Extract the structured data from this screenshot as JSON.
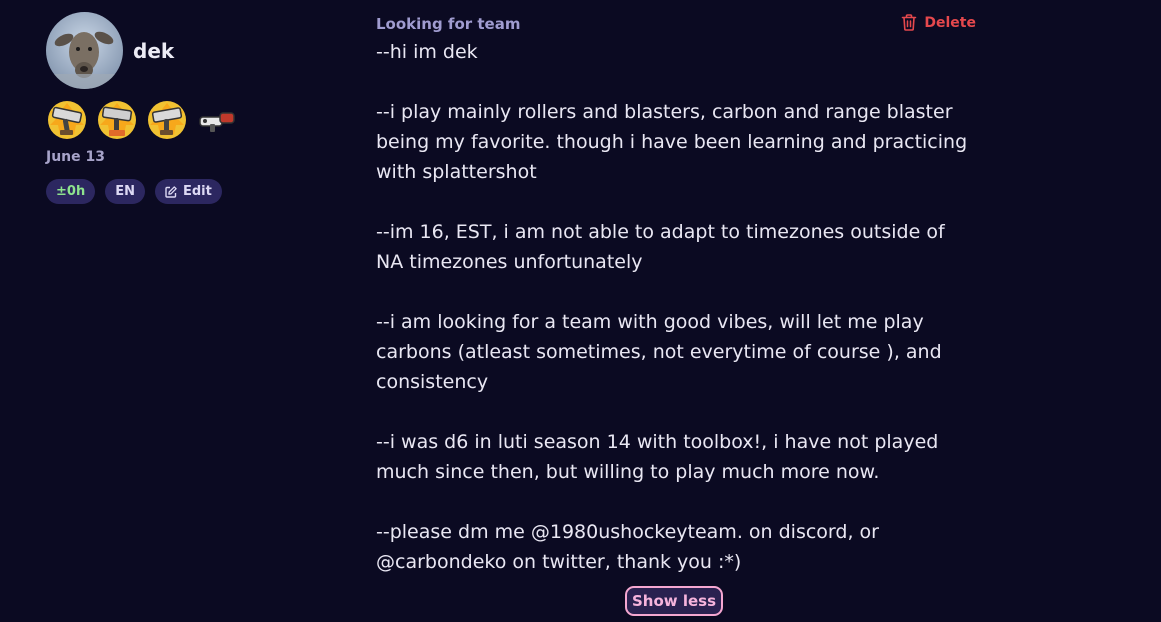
{
  "user": {
    "name": "dek",
    "date": "June 13",
    "weapons": [
      "carbon-roller-icon",
      "carbon-roller-deco-icon",
      "carbon-roller-icon",
      "range-blaster-icon"
    ],
    "pills": {
      "timezone": "±0h",
      "language": "EN",
      "edit": "Edit"
    }
  },
  "post": {
    "type": "Looking for team",
    "delete_label": "Delete",
    "text": "--hi im dek\n\n--i play mainly rollers and blasters, carbon and range blaster being my favorite. though i have been learning and practicing with splattershot\n\n--im 16, EST, i am not able to adapt to timezones outside of NA timezones unfortunately\n\n--i am looking for a team with good vibes, will let me play carbons (atleast sometimes, not everytime of course ), and consistency\n\n--i was d6 in luti season 14 with toolbox!, i have not played much since then, but willing to play much more now.\n\n--please dm me @1980ushockeyteam. on discord, or @carbondeko on twitter, thank you :*)",
    "show_less_label": "Show less"
  },
  "colors": {
    "background": "#0b0a22",
    "accent_delete": "#e5484d",
    "accent_show_less": "#f5a7d1",
    "pill_bg": "#2c2760",
    "timezone_green": "#8ee48e"
  }
}
